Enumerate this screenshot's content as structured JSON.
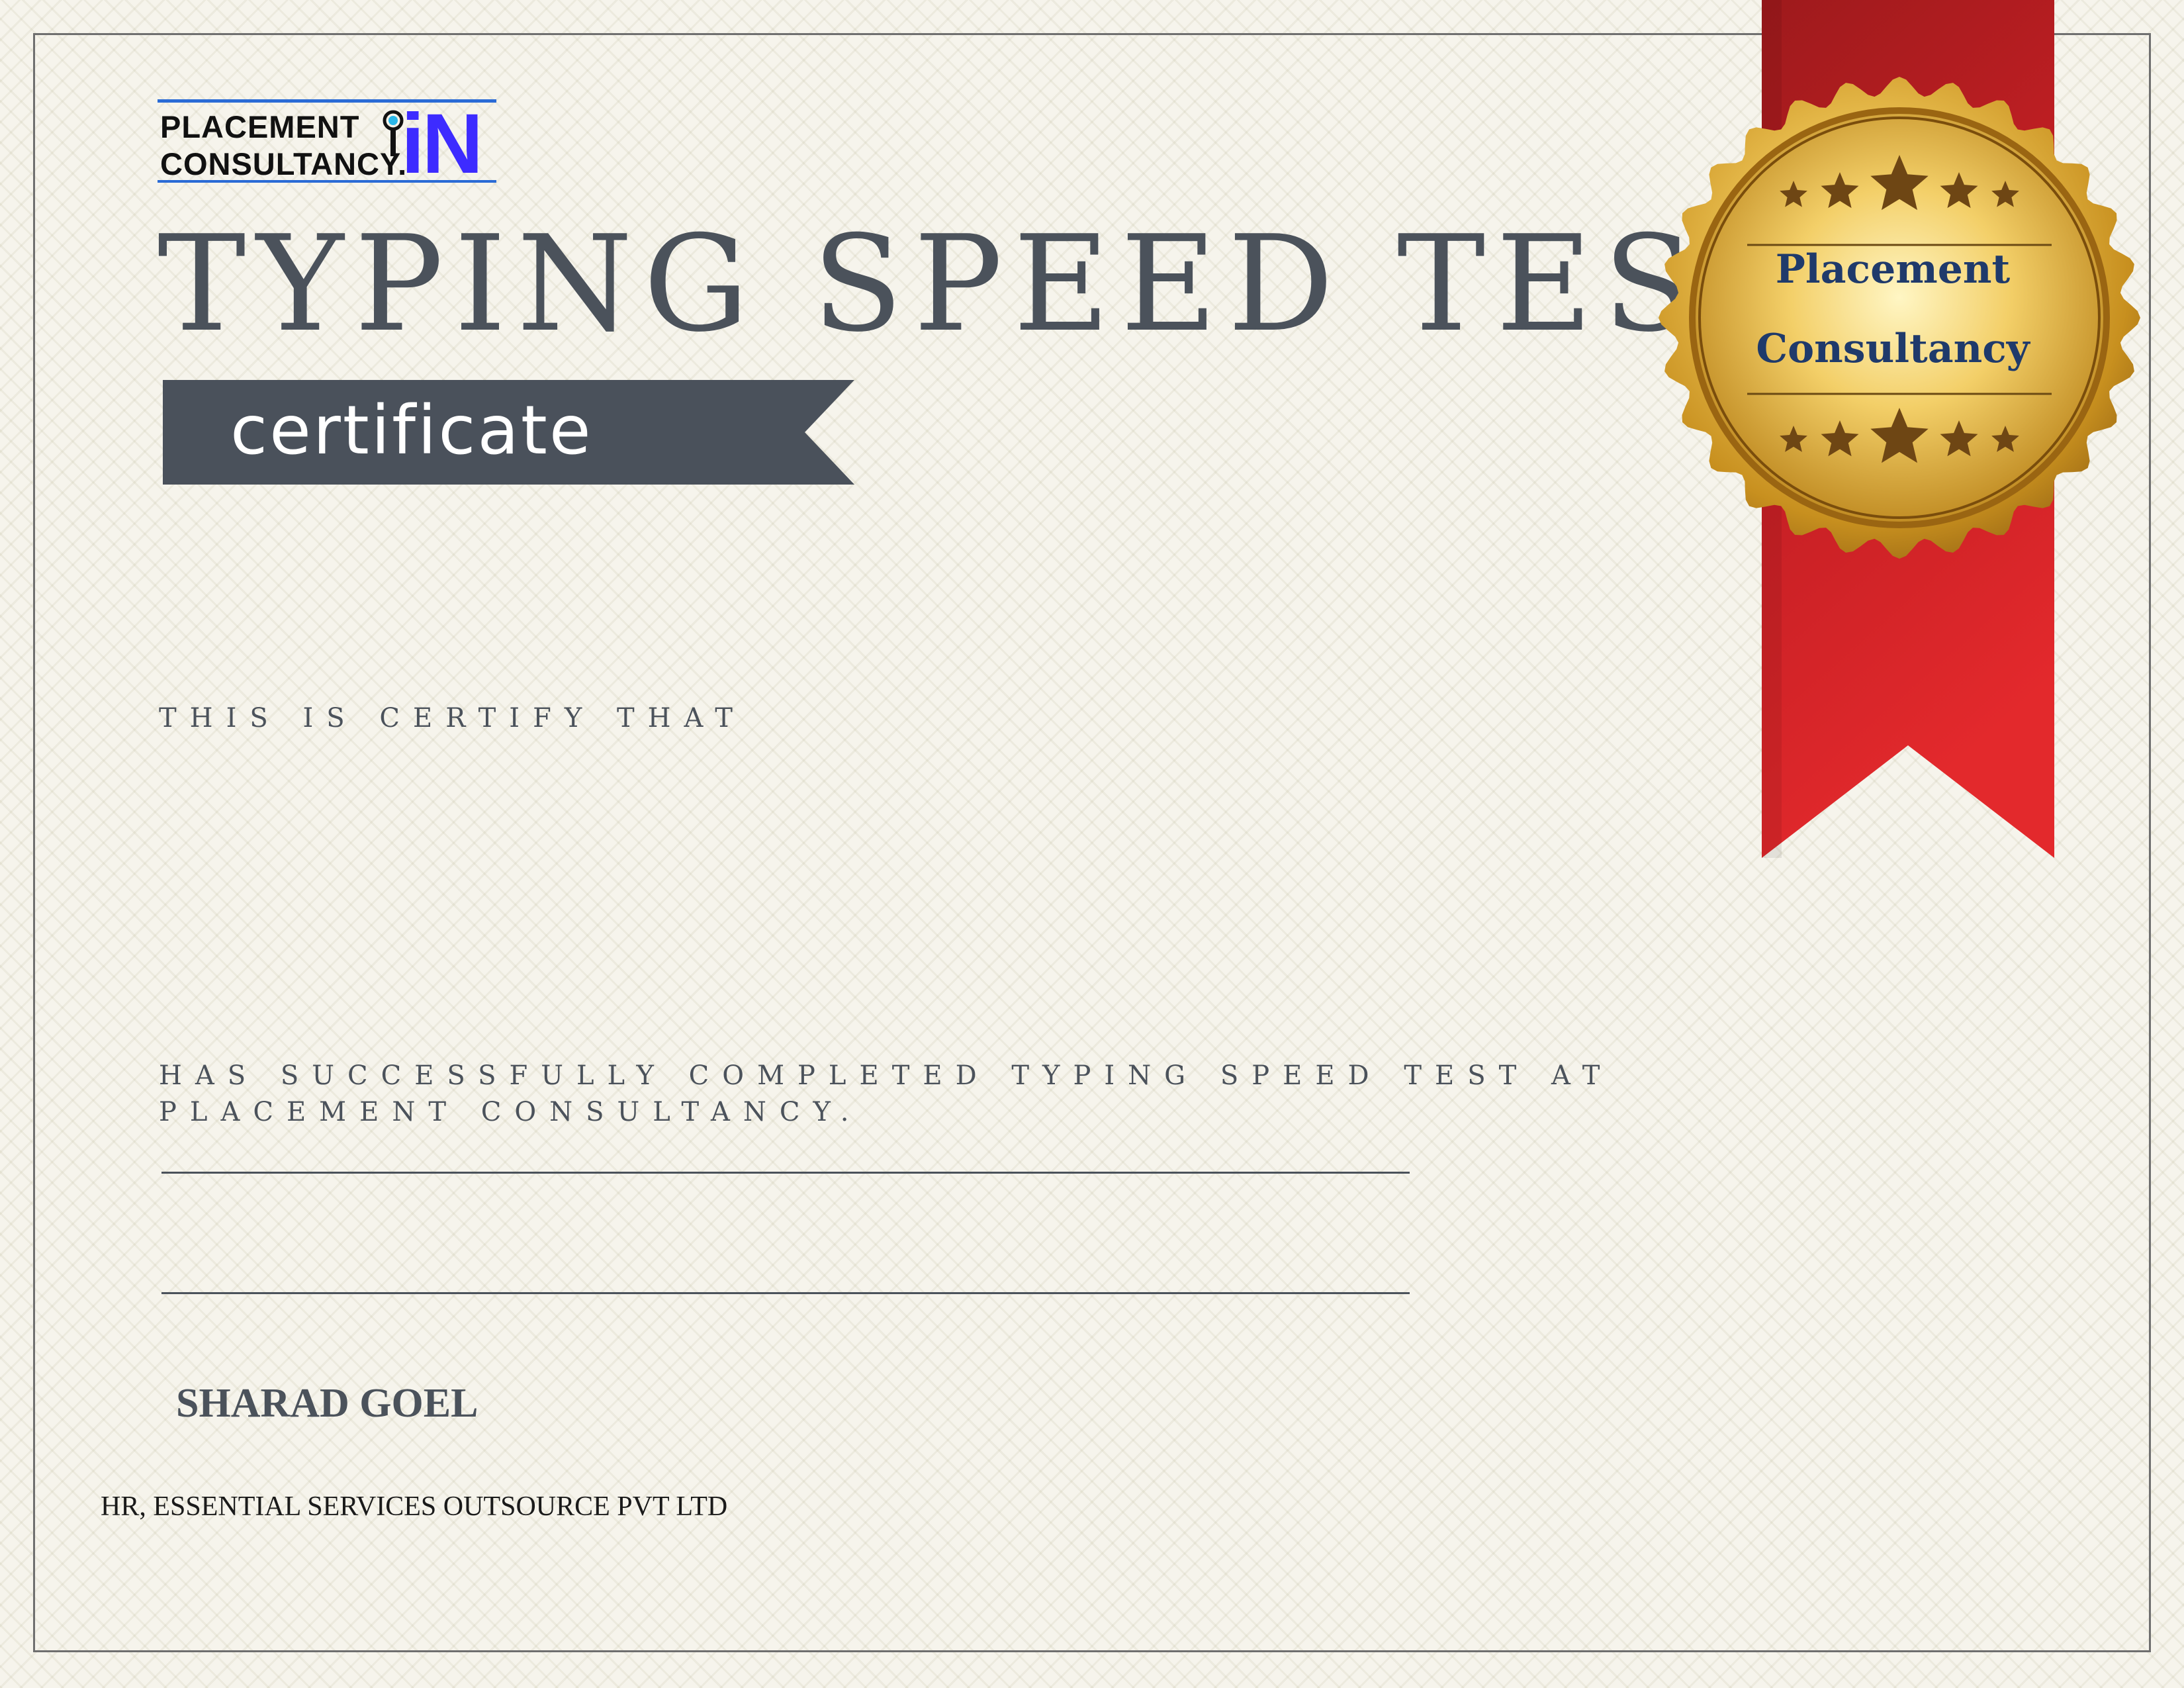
{
  "logo": {
    "line1": "PLACEMENT",
    "line2": "CONSULTANCY.",
    "mark": "iN",
    "colors": {
      "mark": "#3d2bff",
      "bars": "#2a6bd6"
    }
  },
  "title": "TYPING SPEED TEST",
  "banner": {
    "label": "certificate",
    "color": "#4a515b"
  },
  "certify_text": "THIS IS CERTIFY THAT",
  "completed_text": "HAS SUCCESSFULLY COMPLETED TYPING SPEED TEST AT PLACEMENT CONSULTANCY.",
  "signer": {
    "name": "SHARAD GOEL",
    "title": "HR, ESSENTIAL SERVICES OUTSOURCE PVT LTD"
  },
  "seal": {
    "line1": "Placement",
    "line2": "Consultancy",
    "icon": "gold-medal-seal",
    "colors": {
      "gold": "#d4a02a",
      "text": "#1f3a6b"
    }
  },
  "ribbon": {
    "icon": "red-ribbon",
    "color": "#c81e24"
  }
}
